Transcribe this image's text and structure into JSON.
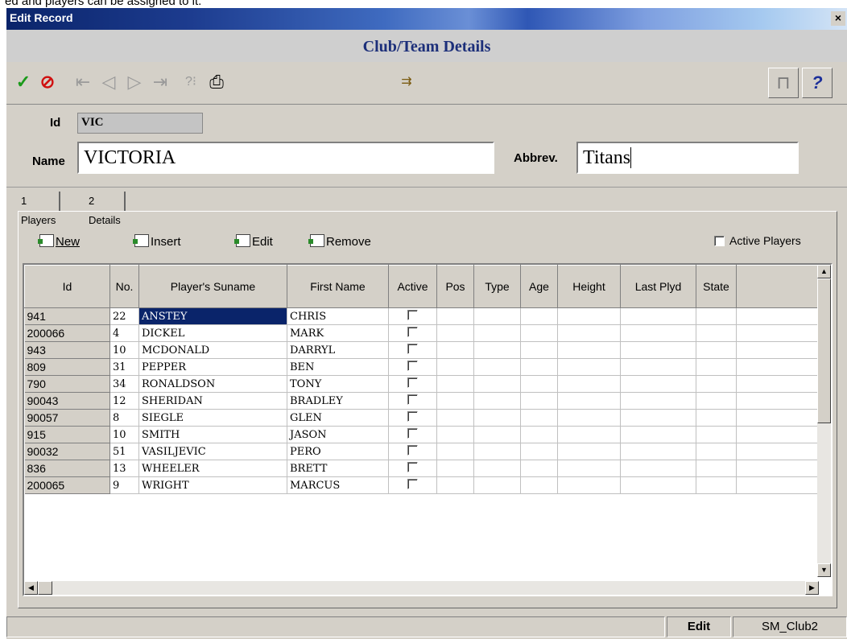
{
  "page_caption": "ed and players can be assigned to it.",
  "window": {
    "title": "Edit Record",
    "close_glyph": "×"
  },
  "form_title": "Club/Team Details",
  "toolbar": {
    "ok_glyph": "✓",
    "cancel_glyph": "⊘",
    "first_glyph": "⇤",
    "prev_glyph": "◁",
    "next_glyph": "▷",
    "last_glyph": "⇥",
    "find_glyph": "?⁝",
    "print_glyph": "⎙",
    "navigate_glyph": "⇉",
    "exit_glyph": "⊓",
    "help_glyph": "?"
  },
  "header": {
    "id_label": "Id",
    "id_value": "VIC",
    "name_label": "Name",
    "name_value": "VICTORIA",
    "abbrev_label": "Abbrev.",
    "abbrev_value": "Titans"
  },
  "tabs": [
    {
      "label": "1 Players",
      "active": true
    },
    {
      "label": "2 Details",
      "active": false
    }
  ],
  "commands": {
    "new_label": "New",
    "insert_label": "Insert",
    "edit_label": "Edit",
    "remove_label": "Remove",
    "active_players_label": "Active Players"
  },
  "grid": {
    "columns": [
      "Id",
      "No.",
      "Player's Suname",
      "First Name",
      "Active",
      "Pos",
      "Type",
      "Age",
      "Height",
      "Last Plyd",
      "State"
    ],
    "rows": [
      {
        "id": "941",
        "no": "22",
        "surname": "ANSTEY",
        "first": "CHRIS",
        "selected": true
      },
      {
        "id": "200066",
        "no": "4",
        "surname": "DICKEL",
        "first": "MARK"
      },
      {
        "id": "943",
        "no": "10",
        "surname": "MCDONALD",
        "first": "DARRYL"
      },
      {
        "id": "809",
        "no": "31",
        "surname": "PEPPER",
        "first": "BEN"
      },
      {
        "id": "790",
        "no": "34",
        "surname": "RONALDSON",
        "first": "TONY"
      },
      {
        "id": "90043",
        "no": "12",
        "surname": "SHERIDAN",
        "first": "BRADLEY"
      },
      {
        "id": "90057",
        "no": "8",
        "surname": "SIEGLE",
        "first": "GLEN"
      },
      {
        "id": "915",
        "no": "10",
        "surname": "SMITH",
        "first": "JASON"
      },
      {
        "id": "90032",
        "no": "51",
        "surname": "VASILJEVIC",
        "first": "PERO"
      },
      {
        "id": "836",
        "no": "13",
        "surname": "WHEELER",
        "first": "BRETT"
      },
      {
        "id": "200065",
        "no": "9",
        "surname": "WRIGHT",
        "first": "MARCUS"
      }
    ]
  },
  "statusbar": {
    "mode": "Edit",
    "form_name": "SM_Club2"
  },
  "colors": {
    "title_start": "#0a246a",
    "form_title": "#1c2f7a",
    "selection": "#0a246a",
    "ok_green": "#1a9a1a",
    "cancel_red": "#d01010",
    "help_blue": "#1c2f9a"
  }
}
